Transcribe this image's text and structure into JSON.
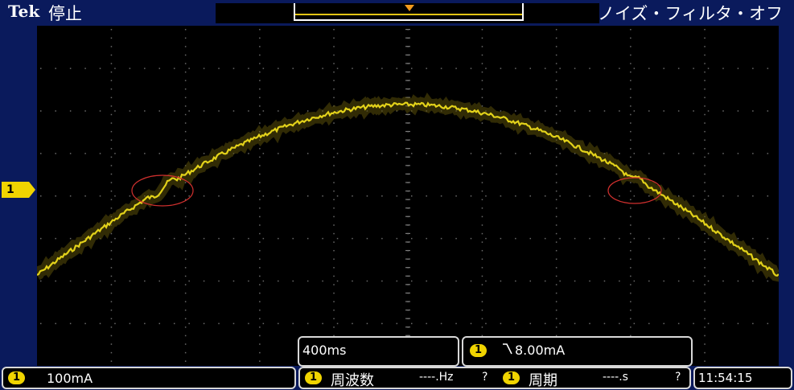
{
  "header": {
    "brand": "Tek",
    "status": "停止",
    "noise_filter": "ノイズ・フィルタ・オフ"
  },
  "channel": {
    "marker": "1",
    "scale": "100mA"
  },
  "timebase": "400ms",
  "trigger": {
    "channel": "1",
    "slope_icon": "falling-edge-icon",
    "level": "8.00mA"
  },
  "measurements": [
    {
      "channel": "1",
      "name": "周波数",
      "value": "----.Hz",
      "flag": "?"
    },
    {
      "channel": "1",
      "name": "周期",
      "value": "----.s",
      "flag": "?"
    }
  ],
  "clock": "11:54:15",
  "colors": {
    "trace": "#e3d21a",
    "background": "#0a1a5c",
    "annotation": "#d0302e",
    "trigger_marker": "#f39a1c"
  }
}
